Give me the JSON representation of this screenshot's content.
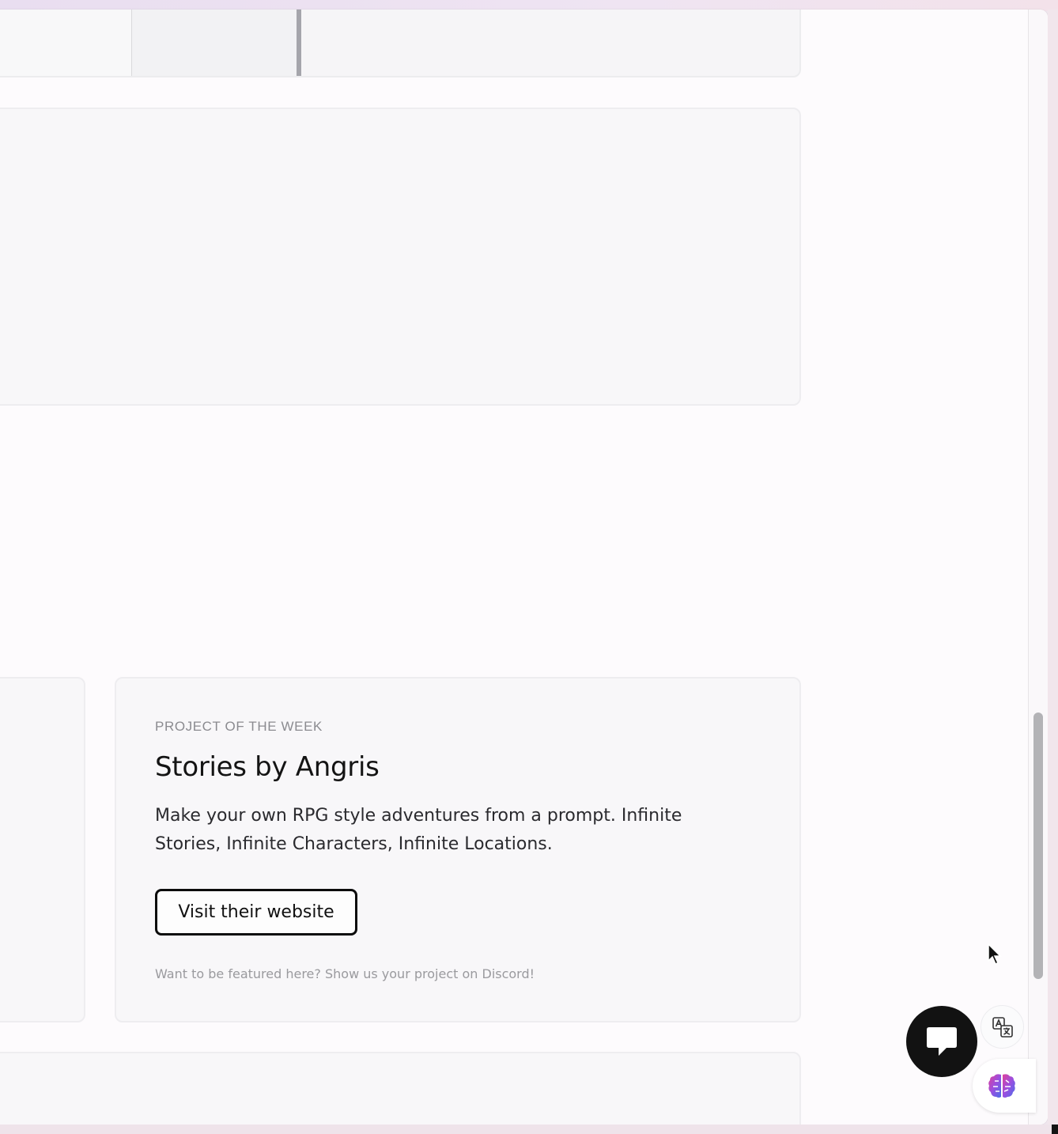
{
  "feature": {
    "eyebrow": "PROJECT OF THE WEEK",
    "title": "Stories by Angris",
    "description": "Make your own RPG style adventures from a prompt. Infinite Stories, Infinite Characters, Infinite Locations.",
    "button_label": "Visit their website",
    "note": "Want to be featured here? Show us your project on Discord!"
  },
  "floating": {
    "chat_icon": "chat-bubble-icon",
    "translate_icon": "translate-icon",
    "brain_icon": "brain-icon"
  },
  "colors": {
    "page_bg": "#fdfbfd",
    "card_bg": "#f8f7f9",
    "card_border": "#eeedf0",
    "text_primary": "#141414",
    "text_muted": "#9a9a9e",
    "chat_button": "#121212"
  }
}
